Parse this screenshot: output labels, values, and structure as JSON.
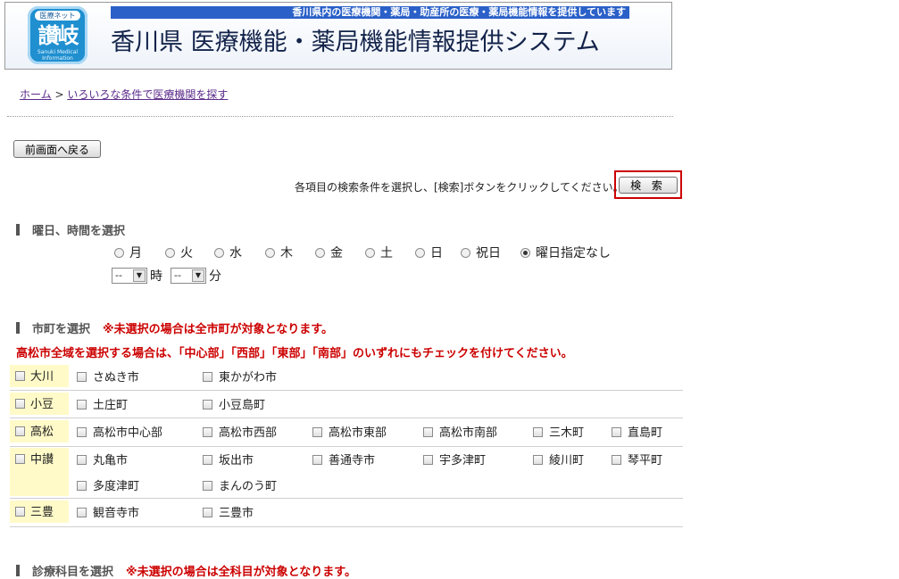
{
  "header": {
    "logo_top": "医療ネット",
    "logo_main": "讃岐",
    "logo_sub": "Sanuki Medical Information",
    "tagline": "香川県内の医療機関・薬局・助産所の医療・薬局機能情報を提供しています",
    "title": "香川県 医療機能・薬局機能情報提供システム"
  },
  "breadcrumb": {
    "home": "ホーム",
    "separator": ">",
    "current": "いろいろな条件で医療機関を探す"
  },
  "back_button": "前画面へ戻る",
  "instruction": "各項目の検索条件を選択し、[検索]ボタンをクリックしてください。→",
  "search_button": "検 索",
  "day_section": {
    "heading": "曜日、時間を選択",
    "days": [
      "月",
      "火",
      "水",
      "木",
      "金",
      "土",
      "日",
      "祝日",
      "曜日指定なし"
    ],
    "selected": "曜日指定なし",
    "hour_value": "--",
    "hour_unit": "時",
    "minute_value": "--",
    "minute_unit": "分"
  },
  "city_section": {
    "heading": "市町を選択",
    "note": "※未選択の場合は全市町が対象となります。",
    "takamatsu_note": "高松市全域を選択する場合は、「中心部」「西部」「東部」「南部」のいずれにもチェックを付けてください。",
    "regions": [
      {
        "name": "大川",
        "rows": [
          [
            "さぬき市",
            "東かがわ市"
          ]
        ]
      },
      {
        "name": "小豆",
        "rows": [
          [
            "土庄町",
            "小豆島町"
          ]
        ]
      },
      {
        "name": "高松",
        "rows": [
          [
            "高松市中心部",
            "高松市西部",
            "高松市東部",
            "高松市南部",
            "三木町",
            "直島町"
          ]
        ]
      },
      {
        "name": "中讃",
        "rows": [
          [
            "丸亀市",
            "坂出市",
            "善通寺市",
            "宇多津町",
            "綾川町",
            "琴平町"
          ],
          [
            "多度津町",
            "まんのう町"
          ]
        ]
      },
      {
        "name": "三豊",
        "rows": [
          [
            "観音寺市",
            "三豊市"
          ]
        ]
      }
    ]
  },
  "dept_section": {
    "heading": "診療科目を選択",
    "note": "※未選択の場合は全科目が対象となります。"
  }
}
